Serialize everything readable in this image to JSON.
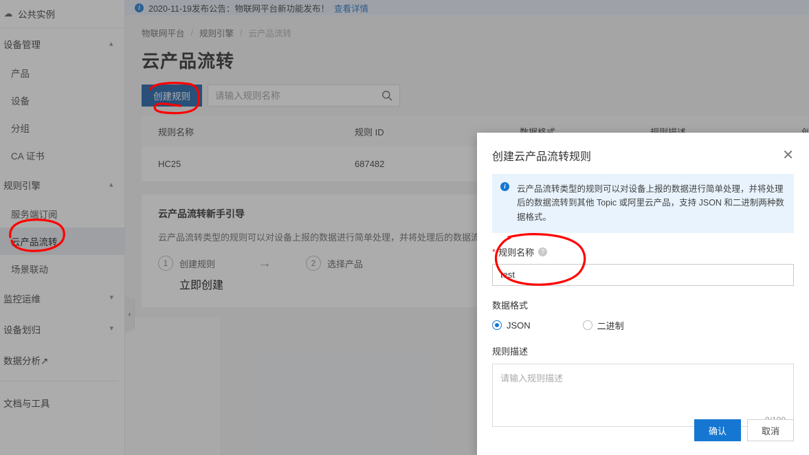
{
  "notice": {
    "icon": "info-circle-icon",
    "text": "2020-11-19发布公告：物联网平台新功能发布！",
    "link": "查看详情"
  },
  "sidebar": {
    "instance": {
      "label": "公共实例",
      "icon": "cloud-icon"
    },
    "groups": [
      {
        "label": "设备管理",
        "expanded": true,
        "items": [
          {
            "label": "产品",
            "active": false
          },
          {
            "label": "设备",
            "active": false
          },
          {
            "label": "分组",
            "active": false
          },
          {
            "label": "CA 证书",
            "active": false
          }
        ]
      },
      {
        "label": "规则引擎",
        "expanded": true,
        "items": [
          {
            "label": "服务端订阅",
            "active": false
          },
          {
            "label": "云产品流转",
            "active": true
          },
          {
            "label": "场景联动",
            "active": false
          }
        ]
      },
      {
        "label": "监控运维",
        "expanded": false,
        "items": []
      },
      {
        "label": "设备划归",
        "expanded": false,
        "items": []
      }
    ],
    "standalone": [
      {
        "label": "数据分析",
        "external": true
      },
      {
        "label": "文档与工具",
        "external": false
      }
    ],
    "collapse_icon": "chevron-left-icon"
  },
  "breadcrumb": [
    "物联网平台",
    "规则引擎",
    "云产品流转"
  ],
  "page_title": "云产品流转",
  "toolbar": {
    "create_rule_label": "创建规则",
    "search_placeholder": "请输入规则名称",
    "search_value": "",
    "search_icon": "search-icon"
  },
  "table": {
    "columns": [
      "规则名称",
      "规则 ID",
      "数据格式",
      "规则描述",
      "创建时间"
    ],
    "rows": [
      {
        "name": "HC25",
        "id": "687482",
        "format": "",
        "desc": "",
        "created": ""
      }
    ]
  },
  "guide": {
    "title": "云产品流转新手引导",
    "description": "云产品流转类型的规则可以对设备上报的数据进行简单处理，并将处理后的数据流转到其他 T",
    "steps": [
      {
        "num": "1",
        "label": "创建规则",
        "sub": "立即创建"
      },
      {
        "num": "2",
        "label": "选择产品",
        "sub": ""
      }
    ],
    "arrow_icon": "arrow-right-icon"
  },
  "modal": {
    "title": "创建云产品流转规则",
    "close_icon": "close-icon",
    "banner": {
      "icon": "info-circle-icon",
      "text": "云产品流转类型的规则可以对设备上报的数据进行简单处理，并将处理后的数据流转到其他 Topic 或阿里云产品，支持 JSON 和二进制两种数据格式。"
    },
    "rule_name": {
      "label": "规则名称",
      "required_mark": "*",
      "help_icon": "question-circle-icon",
      "value": "test",
      "placeholder": ""
    },
    "data_format": {
      "label": "数据格式",
      "options": [
        {
          "label": "JSON",
          "checked": true
        },
        {
          "label": "二进制",
          "checked": false
        }
      ]
    },
    "rule_desc": {
      "label": "规则描述",
      "placeholder": "请输入规则描述",
      "value": "",
      "counter": "0/100"
    },
    "confirm_label": "确认",
    "cancel_label": "取消"
  },
  "colors": {
    "primary": "#1677d2",
    "create_button": "#0f58a3",
    "banner_bg": "#e8f3fd",
    "notice_bg": "#e6edf7",
    "annotation": "#fe0000",
    "link": "#1b6ec2"
  }
}
